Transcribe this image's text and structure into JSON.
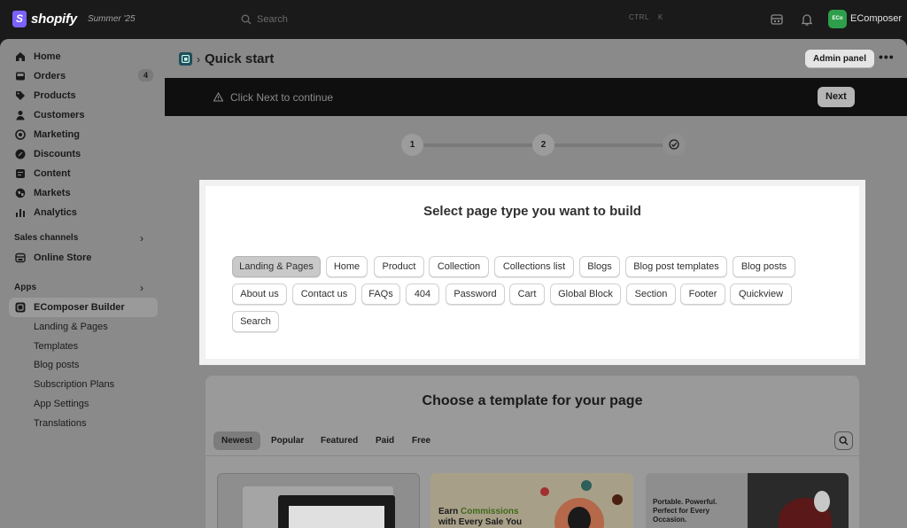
{
  "topbar": {
    "brand": "shopify",
    "edition": "Summer '25",
    "search_placeholder": "Search",
    "shortcut_ctrl": "CTRL",
    "shortcut_key": "K",
    "store_avatar": "ECo",
    "store_name": "EComposer"
  },
  "sidebar": {
    "items": [
      {
        "label": "Home",
        "icon": "home-icon"
      },
      {
        "label": "Orders",
        "icon": "inbox-icon",
        "badge": "4"
      },
      {
        "label": "Products",
        "icon": "tag-icon"
      },
      {
        "label": "Customers",
        "icon": "person-icon"
      },
      {
        "label": "Marketing",
        "icon": "target-icon"
      },
      {
        "label": "Discounts",
        "icon": "discount-icon"
      },
      {
        "label": "Content",
        "icon": "content-icon"
      },
      {
        "label": "Markets",
        "icon": "globe-icon"
      },
      {
        "label": "Analytics",
        "icon": "bar-chart-icon"
      }
    ],
    "sales_channels_label": "Sales channels",
    "online_store_label": "Online Store",
    "apps_label": "Apps",
    "app_name": "EComposer Builder",
    "app_sub_items": [
      "Landing & Pages",
      "Templates",
      "Blog posts",
      "Subscription Plans",
      "App Settings",
      "Translations"
    ]
  },
  "header": {
    "title": "Quick start",
    "admin_panel_label": "Admin panel",
    "more_label": "•••"
  },
  "banner": {
    "text": "Click Next to continue",
    "next_label": "Next"
  },
  "stepper": {
    "steps": [
      "1",
      "2"
    ]
  },
  "page_type": {
    "title": "Select page type you want to build",
    "selected": "Landing & Pages",
    "options": [
      "Landing & Pages",
      "Home",
      "Product",
      "Collection",
      "Collections list",
      "Blogs",
      "Blog post templates",
      "Blog posts",
      "About us",
      "Contact us",
      "FAQs",
      "404",
      "Password",
      "Cart",
      "Global Block",
      "Section",
      "Footer",
      "Quickview",
      "Search"
    ]
  },
  "templates": {
    "title": "Choose a template for your page",
    "tabs": [
      "Newest",
      "Popular",
      "Featured",
      "Paid",
      "Free"
    ],
    "active_tab": "Newest",
    "thumb2_line1_a": "Earn ",
    "thumb2_line1_b": "Commissions",
    "thumb2_line2": "with Every Sale You",
    "thumb3_text": "Portable. Powerful. Perfect for Every Occasion."
  }
}
